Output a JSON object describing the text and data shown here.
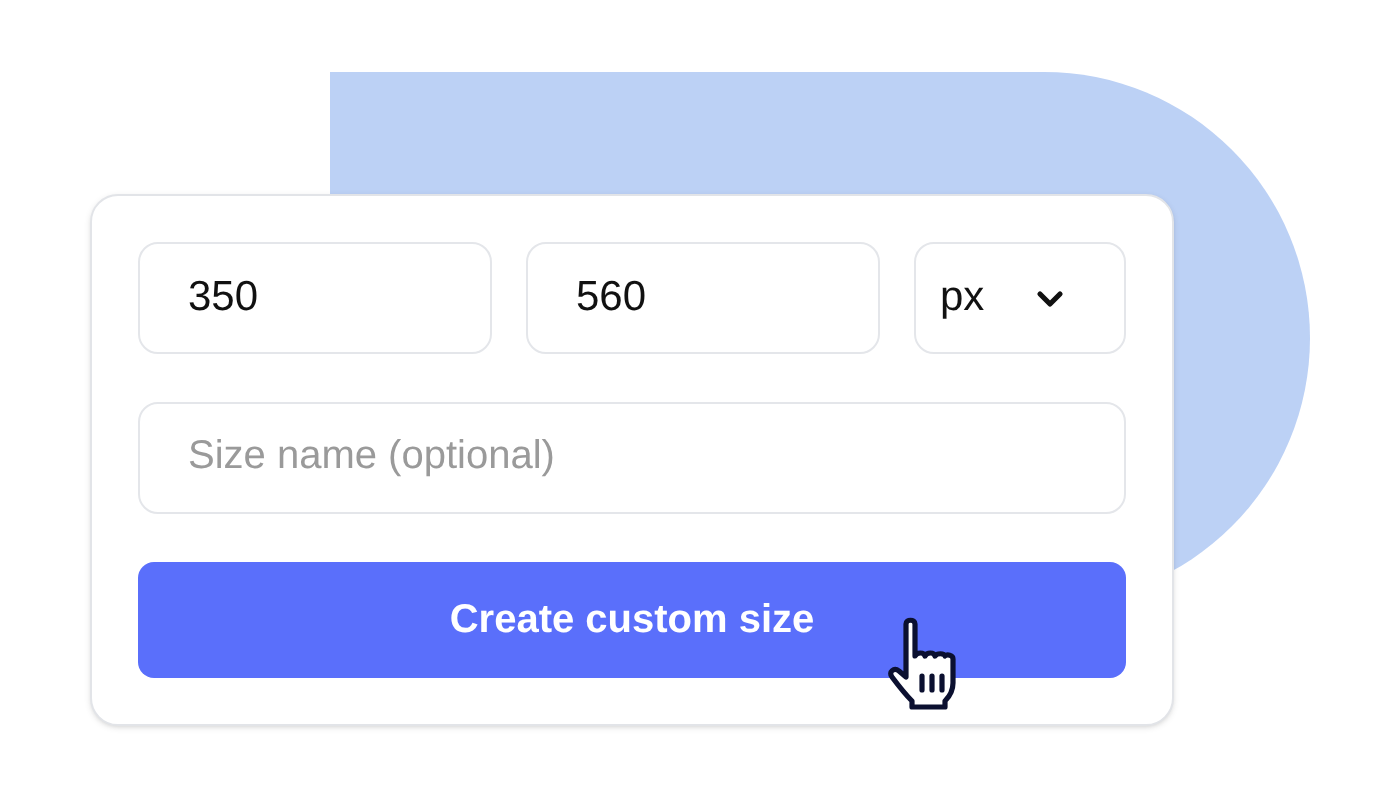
{
  "form": {
    "width": {
      "value": "350"
    },
    "height": {
      "value": "560"
    },
    "unit": {
      "value": "px"
    },
    "size_name": {
      "placeholder": "Size name (optional)"
    },
    "submit_button": {
      "label": "Create custom size"
    }
  }
}
